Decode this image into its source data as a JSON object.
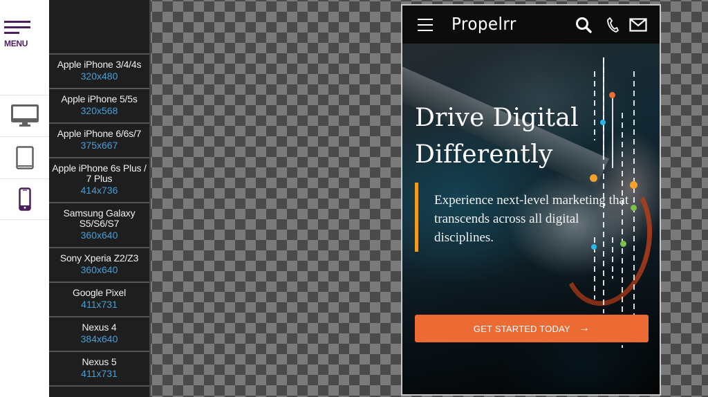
{
  "sidebar": {
    "menu_label": "MENU",
    "views": [
      {
        "name": "desktop",
        "icon": "desktop-icon",
        "active": false
      },
      {
        "name": "tablet",
        "icon": "tablet-icon",
        "active": false
      },
      {
        "name": "mobile",
        "icon": "mobile-icon",
        "active": true
      }
    ],
    "colors": {
      "accent": "#4a1f5c",
      "inactive_icon": "#606060"
    }
  },
  "devices": [
    {
      "name": "Apple iPhone 3/4/4s",
      "size": "320x480"
    },
    {
      "name": "Apple iPhone 5/5s",
      "size": "320x568"
    },
    {
      "name": "Apple iPhone 6/6s/7",
      "size": "375x667"
    },
    {
      "name": "Apple iPhone 6s Plus / 7 Plus",
      "size": "414x736"
    },
    {
      "name": "Samsung Galaxy S5/S6/S7",
      "size": "360x640"
    },
    {
      "name": "Sony Xperia Z2/Z3",
      "size": "360x640"
    },
    {
      "name": "Google Pixel",
      "size": "411x731"
    },
    {
      "name": "Nexus 4",
      "size": "384x640"
    },
    {
      "name": "Nexus 5",
      "size": "411x731"
    }
  ],
  "preview": {
    "logo": "Propelrr",
    "header_icons": [
      "menu-icon",
      "search-icon",
      "phone-icon",
      "mail-icon"
    ],
    "headline_lines": [
      "Drive Digital",
      "Differently"
    ],
    "subheading": "Experience next-level marketing that transcends across all digital disciplines.",
    "cta_label": "GET STARTED TODAY",
    "cta_arrow": "→",
    "colors": {
      "cta": "#ec6a33",
      "accent_bar": "#f39b1d",
      "size_text": "#4a9fd6"
    }
  }
}
